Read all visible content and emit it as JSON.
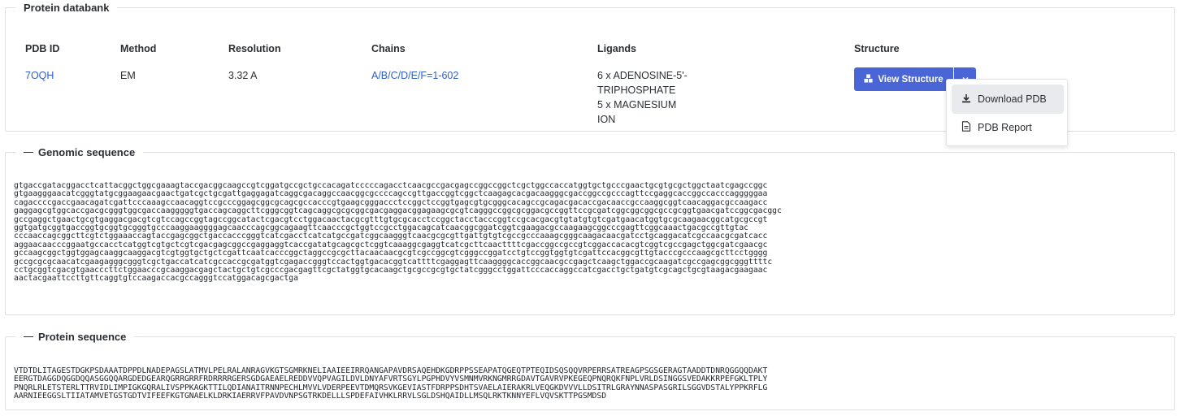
{
  "pdb": {
    "legend": "Protein databank",
    "headers": {
      "pdb_id": "PDB ID",
      "method": "Method",
      "resolution": "Resolution",
      "chains": "Chains",
      "ligands": "Ligands",
      "structure": "Structure"
    },
    "row": {
      "pdb_id": "7OQH",
      "method": "EM",
      "resolution": "3.32 A",
      "chains": "A/B/C/D/E/F=1-602",
      "ligands": [
        "6 x ADENOSINE-5'-",
        "TRIPHOSPHATE",
        "5 x MAGNESIUM",
        "ION"
      ]
    },
    "view_button": "View Structure",
    "menu": {
      "download": "Download PDB",
      "report": "PDB Report"
    },
    "accent": "#4a66d6",
    "link_color": "#2f5fc4"
  },
  "genomic": {
    "legend": "Genomic sequence",
    "lines": [
      "gtgaccgatacggacctcattacggctggcgaaagtaccgacggcaagccgtcggatgccgctgccacagatcccccagacctcaacgccgacgagccggccggctcgctggccaccatggtgctgcccgaactgcgtgcgctggctaatcgagccggc",
      "gtgaagggaacatcgggtatgcggaagaacgaactgatcgctgcgattgaggagatcaggcgacaggccaacggcgccccagccgttgaccggtcggctcaagagcacgacaagggcgaccggccgcccagttccgaggcaccggccacccagggggaa",
      "cagaccccgaccgaacagatcgattcccaaagccaacaggtccgcccggagcggcgcagcgccacccgtgaagcgggaccctccggctccggtgagcgtgcgggcacagccgcagacgacaccgacaaccgccaaggcggtcaacaggacgccaagacc",
      "gaggagcgtggcaccgacgcgggtggcgaccaagggggtgaccagcaggcttcgggcggtcagcaggcgcgcggcgacgaggacggagaagcgcgtcagggccggcgcggacgccggttccgcgatcggcggcggcgccgcggtgaacgatccggcgacggc",
      "gccgaggctgaactgcgtgaggacgacgtcgtccagccggtagccggcatactcgacgtcctggacaactacgcgtttgtgcgcacctccggctacctacccggtccgcacgacgtgtatgtgtcgatgaacatggtgcgcaagaacggcatgcgccgt",
      "ggtgatgcggtgaccggtgcggtgcgggtgcccaaggaaggggagcaacccagcggcagaagttcaacccgctggtccgcctggacagcatcaacggcggatcggtcgaagacgccaagaagcggcccgagttcggcaaactgacgccgttgtac",
      "cccaaccagcggcttcgtctggaaaccagtaccgagcggctgaccacccgggtcatcgacctcatcatgccgatcggcaagggtcaacgcgcgttgattgtgtcgccgcccaaagcgggcaagacaacgatcctgcaggacatcgccaacgcgatcacc",
      "aggaacaacccggaatgccacctcatggtcgtgctcgtcgacgagcggccgaggaggtcaccgatatgcagcgctcggtcaaaggcgaggtcatcgcttcaacttttcgaccggccgccgtcggaccacacgtcggtcgccgagctggcgatcgaacgc",
      "gccaagcggctggtggagcaaggcaaggacgtcgtggtgctgctcgattcaatcacccggctaggccgcgcttacaacaacgcgtcgccggcgtcgggccggatcctgtccggtggtgtcgattccacggcgttgtacccgcccaagcgcttcctgggg",
      "gccgcgcgcaacatcgaagagggcgggtcgctgaccatcatcgccaccgcgatggtcgagaccgggtccactggtgacacggtcattttcgaggagttcaaggggcaccggcaacgccgagctcaagctggaccgcaagatcgccgagcggcgggttttc",
      "cctgcggtcgacgtgaacccttctggaacccgcaaggacgagctactgctgtcgcccgacgagttcgctatggtgcacaagctgcgccgcgtgctatcgggcctggattcccaccaggccatcgacctgctgatgtcgcagctgcgtaagacgaagaac",
      "aactacgaattccttgttcaggtgtccaagaccacgccagggtccatggacagcgactga"
    ]
  },
  "protein": {
    "legend": "Protein sequence",
    "lines": [
      "VTDTDLITAGESTDGKPSDAAATDPPDLNADEPAGSLATMVLPELRALANRAGVKGTSGMRKNELIAAIEEIRRQANGAPAVDRSAQEHDKGDRPPSSEAPATQGEQTPTEQIDSQSQQVRPERRSATREAGPSGSGERAGTAADDTDNRQGGQQDAKT",
      "EERGTDAGGDQGGDQQASGGQQARGDEDGEARQGRRGRRFRDRRRRGERSGDGAEAELREDDVVQPVAGILDVLDNYAFVRTSGYLPGPHDVYVSMNMVRKNGMRRGDAVTGAVRVPKEGEQPNQRQKFNPLVRLDSINGGSVEDAKKRPEFGKLTPLY",
      "PNQRLRLETSTERLTTRVIDLIMPIGKGQRALIVSPPKAGKTTILQDIANAITRNNPECHLMVVLVDERPEEVTDMQRSVKGEVIASTFDRPPSDHTSVAELAIERAKRLVEQGKDVVVLLDSITRLGRAYNNASPASGRILSGGVDSTALYPPKRFLG",
      "AARNIEEGGSLTIIATAMVETGSTGDTVIFEEFKGTGNAELKLDRKIAERRVFPAVDVNPSGTRKDELLLSPDEFAIVHKLRRVLSGLDSHQAIDLLMSQLRKTKNNYEFLVQVSKTTPGSMDSD"
    ]
  }
}
